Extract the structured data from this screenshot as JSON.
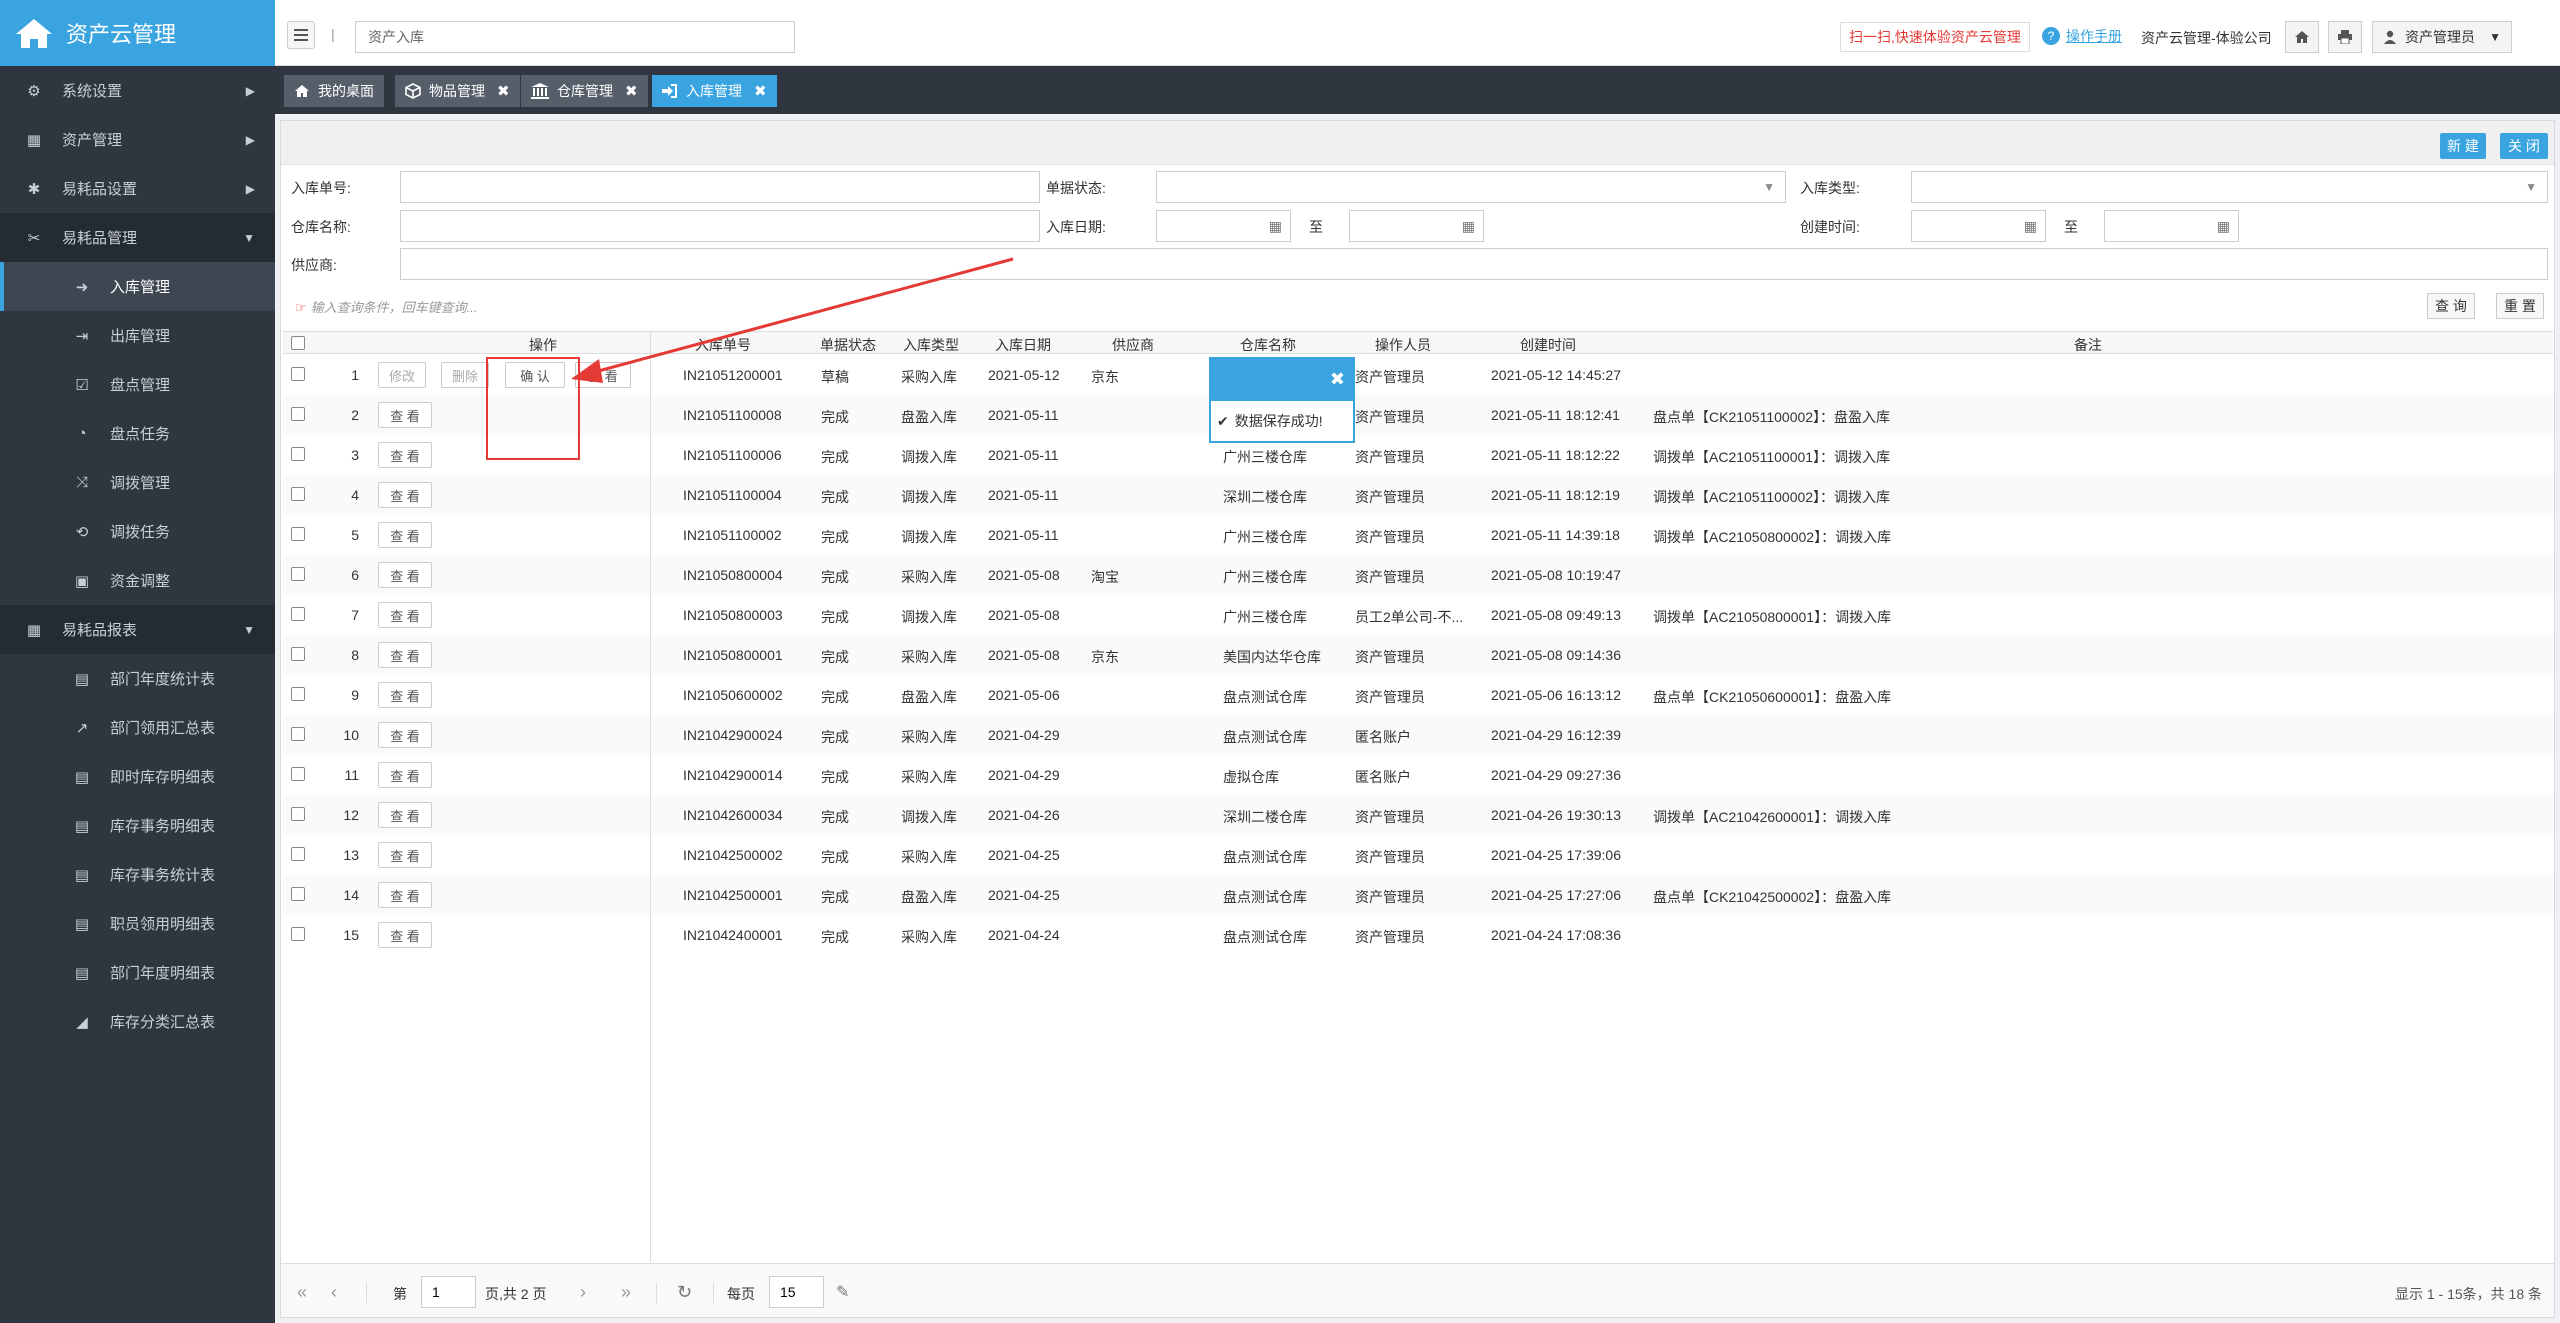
{
  "app": {
    "title": "资产云管理"
  },
  "sidebar": {
    "items": [
      {
        "label": "系统设置",
        "icon": "gears-icon",
        "type": "group"
      },
      {
        "label": "资产管理",
        "icon": "grid-icon",
        "type": "group"
      },
      {
        "label": "易耗品设置",
        "icon": "gear-icon",
        "type": "group"
      },
      {
        "label": "易耗品管理",
        "icon": "tools-icon",
        "type": "group-open"
      },
      {
        "label": "入库管理",
        "icon": "sign-in-icon",
        "type": "sub-active"
      },
      {
        "label": "出库管理",
        "icon": "sign-out-icon",
        "type": "sub"
      },
      {
        "label": "盘点管理",
        "icon": "check-square-icon",
        "type": "sub"
      },
      {
        "label": "盘点任务",
        "icon": "clock-icon",
        "type": "sub"
      },
      {
        "label": "调拨管理",
        "icon": "shuffle-icon",
        "type": "sub"
      },
      {
        "label": "调拨任务",
        "icon": "retweet-icon",
        "type": "sub"
      },
      {
        "label": "资金调整",
        "icon": "money-icon",
        "type": "sub"
      },
      {
        "label": "易耗品报表",
        "icon": "table-icon",
        "type": "group-open"
      },
      {
        "label": "部门年度统计表",
        "icon": "sheet-icon",
        "type": "sub"
      },
      {
        "label": "部门领用汇总表",
        "icon": "line-chart-icon",
        "type": "sub"
      },
      {
        "label": "即时库存明细表",
        "icon": "sheet-icon",
        "type": "sub"
      },
      {
        "label": "库存事务明细表",
        "icon": "sheet-icon",
        "type": "sub"
      },
      {
        "label": "库存事务统计表",
        "icon": "sheet-icon",
        "type": "sub"
      },
      {
        "label": "职员领用明细表",
        "icon": "sheet-icon",
        "type": "sub"
      },
      {
        "label": "部门年度明细表",
        "icon": "sheet-icon",
        "type": "sub"
      },
      {
        "label": "库存分类汇总表",
        "icon": "area-chart-icon",
        "type": "sub"
      }
    ]
  },
  "header": {
    "search_value": "资产入库",
    "scan_label": "扫一扫,快速体验资产云管理",
    "manual_label": "操作手册",
    "company": "资产云管理-体验公司",
    "user": "资产管理员"
  },
  "tabs": [
    {
      "label": "我的桌面",
      "closable": false,
      "active": false
    },
    {
      "label": "物品管理",
      "closable": true,
      "active": false
    },
    {
      "label": "仓库管理",
      "closable": true,
      "active": false
    },
    {
      "label": "入库管理",
      "closable": true,
      "active": true
    }
  ],
  "toolbar": {
    "new_label": "新 建",
    "close_label": "关 闭"
  },
  "filters": {
    "order_no": "入库单号:",
    "status": "单据状态:",
    "in_type": "入库类型:",
    "warehouse": "仓库名称:",
    "in_date": "入库日期:",
    "to1": "至",
    "created": "创建时间:",
    "to2": "至",
    "supplier": "供应商:",
    "hint": "输入查询条件，回车键查询...",
    "query_label": "查 询",
    "reset_label": "重 置"
  },
  "grid": {
    "columns": {
      "ops": "操作",
      "order_no": "入库单号",
      "status": "单据状态",
      "in_type": "入库类型",
      "in_date": "入库日期",
      "supplier": "供应商",
      "warehouse": "仓库名称",
      "operator": "操作人员",
      "created": "创建时间",
      "note": "备注"
    },
    "row1_buttons": {
      "edit": "修改",
      "delete": "删除",
      "confirm": "确 认",
      "view": "查 看"
    },
    "view_label": "查 看",
    "rows": [
      {
        "no": "1",
        "order_no": "IN21051200001",
        "status": "草稿",
        "in_type": "采购入库",
        "in_date": "2021-05-12",
        "supplier": "京东",
        "warehouse": "",
        "operator": "资产管理员",
        "created": "2021-05-12 14:45:27",
        "note": ""
      },
      {
        "no": "2",
        "order_no": "IN21051100008",
        "status": "完成",
        "in_type": "盘盈入库",
        "in_date": "2021-05-11",
        "supplier": "",
        "warehouse": "",
        "operator": "资产管理员",
        "created": "2021-05-11 18:12:41",
        "note": "盘点单【CK21051100002】：盘盈入库"
      },
      {
        "no": "3",
        "order_no": "IN21051100006",
        "status": "完成",
        "in_type": "调拨入库",
        "in_date": "2021-05-11",
        "supplier": "",
        "warehouse": "广州三楼仓库",
        "operator": "资产管理员",
        "created": "2021-05-11 18:12:22",
        "note": "调拨单【AC21051100001】：调拨入库"
      },
      {
        "no": "4",
        "order_no": "IN21051100004",
        "status": "完成",
        "in_type": "调拨入库",
        "in_date": "2021-05-11",
        "supplier": "",
        "warehouse": "深圳二楼仓库",
        "operator": "资产管理员",
        "created": "2021-05-11 18:12:19",
        "note": "调拨单【AC21051100002】：调拨入库"
      },
      {
        "no": "5",
        "order_no": "IN21051100002",
        "status": "完成",
        "in_type": "调拨入库",
        "in_date": "2021-05-11",
        "supplier": "",
        "warehouse": "广州三楼仓库",
        "operator": "资产管理员",
        "created": "2021-05-11 14:39:18",
        "note": "调拨单【AC21050800002】：调拨入库"
      },
      {
        "no": "6",
        "order_no": "IN21050800004",
        "status": "完成",
        "in_type": "采购入库",
        "in_date": "2021-05-08",
        "supplier": "淘宝",
        "warehouse": "广州三楼仓库",
        "operator": "资产管理员",
        "created": "2021-05-08 10:19:47",
        "note": ""
      },
      {
        "no": "7",
        "order_no": "IN21050800003",
        "status": "完成",
        "in_type": "调拨入库",
        "in_date": "2021-05-08",
        "supplier": "",
        "warehouse": "广州三楼仓库",
        "operator": "员工2单公司-不...",
        "created": "2021-05-08 09:49:13",
        "note": "调拨单【AC21050800001】：调拨入库"
      },
      {
        "no": "8",
        "order_no": "IN21050800001",
        "status": "完成",
        "in_type": "采购入库",
        "in_date": "2021-05-08",
        "supplier": "京东",
        "warehouse": "美国内达华仓库",
        "operator": "资产管理员",
        "created": "2021-05-08 09:14:36",
        "note": ""
      },
      {
        "no": "9",
        "order_no": "IN21050600002",
        "status": "完成",
        "in_type": "盘盈入库",
        "in_date": "2021-05-06",
        "supplier": "",
        "warehouse": "盘点测试仓库",
        "operator": "资产管理员",
        "created": "2021-05-06 16:13:12",
        "note": "盘点单【CK21050600001】：盘盈入库"
      },
      {
        "no": "10",
        "order_no": "IN21042900024",
        "status": "完成",
        "in_type": "采购入库",
        "in_date": "2021-04-29",
        "supplier": "",
        "warehouse": "盘点测试仓库",
        "operator": "匿名账户",
        "created": "2021-04-29 16:12:39",
        "note": ""
      },
      {
        "no": "11",
        "order_no": "IN21042900014",
        "status": "完成",
        "in_type": "采购入库",
        "in_date": "2021-04-29",
        "supplier": "",
        "warehouse": "虚拟仓库",
        "operator": "匿名账户",
        "created": "2021-04-29 09:27:36",
        "note": ""
      },
      {
        "no": "12",
        "order_no": "IN21042600034",
        "status": "完成",
        "in_type": "调拨入库",
        "in_date": "2021-04-26",
        "supplier": "",
        "warehouse": "深圳二楼仓库",
        "operator": "资产管理员",
        "created": "2021-04-26 19:30:13",
        "note": "调拨单【AC21042600001】：调拨入库"
      },
      {
        "no": "13",
        "order_no": "IN21042500002",
        "status": "完成",
        "in_type": "采购入库",
        "in_date": "2021-04-25",
        "supplier": "",
        "warehouse": "盘点测试仓库",
        "operator": "资产管理员",
        "created": "2021-04-25 17:39:06",
        "note": ""
      },
      {
        "no": "14",
        "order_no": "IN21042500001",
        "status": "完成",
        "in_type": "盘盈入库",
        "in_date": "2021-04-25",
        "supplier": "",
        "warehouse": "盘点测试仓库",
        "operator": "资产管理员",
        "created": "2021-04-25 17:27:06",
        "note": "盘点单【CK21042500002】：盘盈入库"
      },
      {
        "no": "15",
        "order_no": "IN21042400001",
        "status": "完成",
        "in_type": "采购入库",
        "in_date": "2021-04-24",
        "supplier": "",
        "warehouse": "盘点测试仓库",
        "operator": "资产管理员",
        "created": "2021-04-24 17:08:36",
        "note": ""
      }
    ]
  },
  "pager": {
    "page_prefix": "第",
    "page": "1",
    "page_suffix": "页,共 2 页",
    "per_page_label": "每页",
    "per_page": "15",
    "summary": "显示 1 - 15条，共 18 条"
  },
  "popup": {
    "message": "数据保存成功!"
  },
  "colors": {
    "accent": "#3aa4e0",
    "sidebar": "#2f3640",
    "annotation": "#e53935"
  }
}
